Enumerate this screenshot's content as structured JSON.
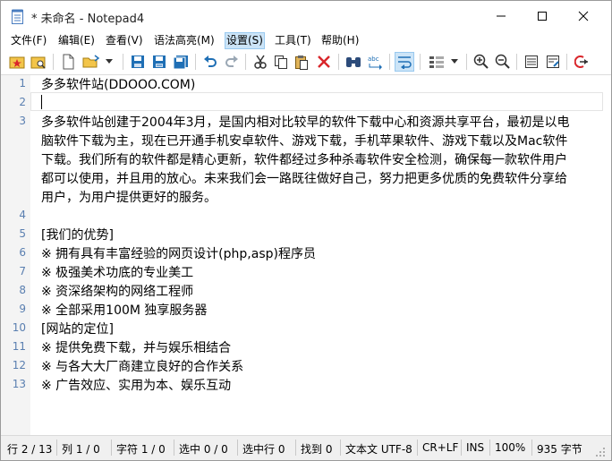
{
  "window": {
    "title": "* 未命名 - Notepad4",
    "controls": [
      "minimize",
      "maximize",
      "close"
    ]
  },
  "menu": [
    {
      "label": "文件(F)"
    },
    {
      "label": "编辑(E)"
    },
    {
      "label": "查看(V)"
    },
    {
      "label": "语法高亮(M)"
    },
    {
      "label": "设置(S)",
      "active": true
    },
    {
      "label": "工具(T)"
    },
    {
      "label": "帮助(H)"
    }
  ],
  "toolbar": [
    "new-icon",
    "open-icon",
    "dropdown-icon",
    "save-icon",
    "save-as-icon",
    "save-copy-icon",
    "undo-icon",
    "redo-icon",
    "cut-icon",
    "copy-icon",
    "paste-icon",
    "delete-icon",
    "find-icon",
    "replace-icon",
    "word-wrap-icon",
    "view-icon",
    "zoom-in-icon",
    "zoom-out-icon",
    "schemes-icon",
    "customize-icon",
    "exit-icon"
  ],
  "editor": {
    "lines": [
      {
        "num": "1",
        "text": "多多软件站(DDOOO.COM)"
      },
      {
        "num": "2",
        "text": ""
      },
      {
        "num": "3",
        "text": "多多软件站创建于2004年3月，是国内相对比较早的软件下载中心和资源共享平台，最初是以电"
      },
      {
        "num": "",
        "text": "脑软件下载为主，现在已开通手机安卓软件、游戏下载，手机苹果软件、游戏下载以及Mac软件"
      },
      {
        "num": "",
        "text": "下载。我们所有的软件都是精心更新，软件都经过多种杀毒软件安全检测，确保每一款软件用户"
      },
      {
        "num": "",
        "text": "都可以使用，并且用的放心。未来我们会一路既往做好自己，努力把更多优质的免费软件分享给"
      },
      {
        "num": "",
        "text": "用户，为用户提供更好的服务。"
      },
      {
        "num": "4",
        "text": ""
      },
      {
        "num": "5",
        "text": "[我们的优势]"
      },
      {
        "num": "6",
        "text": "※ 拥有具有丰富经验的网页设计(php,asp)程序员"
      },
      {
        "num": "7",
        "text": "※ 极强美术功底的专业美工"
      },
      {
        "num": "8",
        "text": "※ 资深络架构的网络工程师"
      },
      {
        "num": "9",
        "text": "※ 全部采用100M 独享服务器"
      },
      {
        "num": "10",
        "text": "[网站的定位]"
      },
      {
        "num": "11",
        "text": "※ 提供免费下载，并与娱乐相结合"
      },
      {
        "num": "12",
        "text": "※ 与各大大厂商建立良好的合作关系"
      },
      {
        "num": "13",
        "text": "※ 广告效应、实用为本、娱乐互动"
      }
    ]
  },
  "status": {
    "line": "行 2 / 13",
    "col": "列 1 / 0",
    "char": "字符 1 / 0",
    "selection": "选中 0 / 0",
    "selected_lines": "选中行 0",
    "matches": "找到 0",
    "encoding": "文本文 UTF-8",
    "eol": "CR+LF",
    "ins": "INS",
    "zoom": "100%",
    "size": "935 字节"
  },
  "colors": {
    "accent": "#cce4f7",
    "line_number": "#5a7fb0",
    "save_icon": "#1f6fb5",
    "delete_icon": "#d9262b"
  }
}
